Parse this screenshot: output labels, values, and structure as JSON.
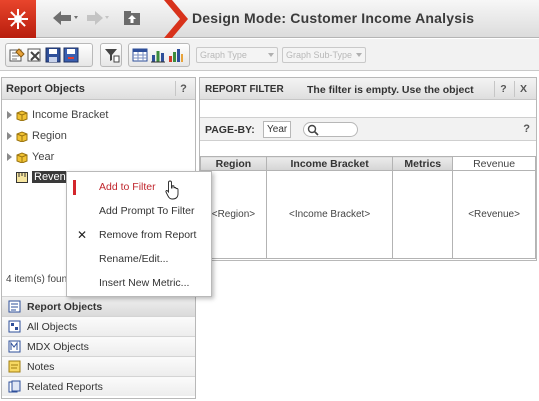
{
  "header": {
    "title": "Design Mode: Customer Income Analysis",
    "accent": "#d8321b"
  },
  "toolbar": {
    "graph_type": "Graph Type",
    "graph_subtype": "Graph Sub-Type"
  },
  "left_panel": {
    "title": "Report Objects",
    "help": "?",
    "tree": [
      {
        "label": "Income Bracket"
      },
      {
        "label": "Region"
      },
      {
        "label": "Year"
      },
      {
        "label": "Revenue"
      }
    ],
    "items_found": "4 item(s) found",
    "bottom_nav": [
      {
        "label": "Report Objects"
      },
      {
        "label": "All Objects"
      },
      {
        "label": "MDX Objects"
      },
      {
        "label": "Notes"
      },
      {
        "label": "Related Reports"
      }
    ]
  },
  "report_filter": {
    "title": "REPORT FILTER",
    "message": "The filter is empty. Use the object",
    "help": "?",
    "close": "X"
  },
  "page_by": {
    "label": "PAGE-BY:",
    "chip": "Year",
    "help": "?"
  },
  "grid": {
    "headers": [
      "Region",
      "Income Bracket",
      "Metrics",
      "Revenue"
    ],
    "cells": [
      "<Region>",
      "<Income Bracket>",
      "",
      "<Revenue>"
    ]
  },
  "context_menu": {
    "items": [
      {
        "label": "Add to Filter"
      },
      {
        "label": "Add Prompt To Filter"
      },
      {
        "label": "Remove from Report"
      },
      {
        "label": "Rename/Edit..."
      },
      {
        "label": "Insert New Metric..."
      }
    ]
  }
}
